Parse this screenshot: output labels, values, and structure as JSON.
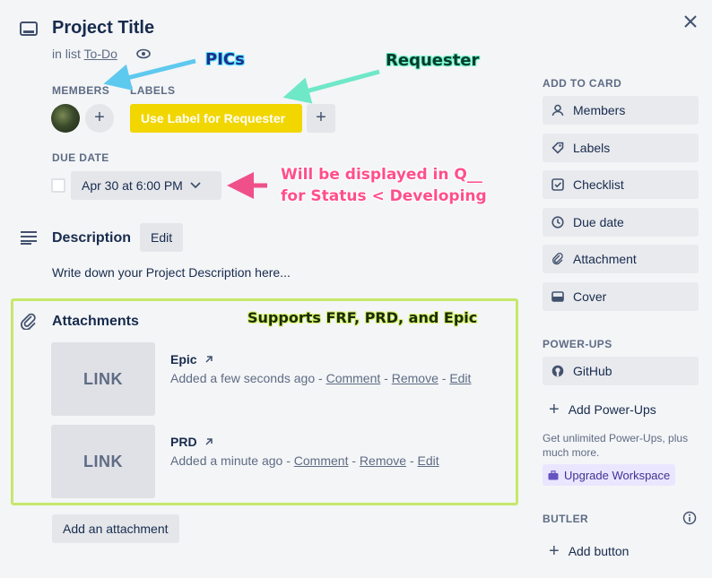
{
  "card": {
    "title": "Project Title",
    "in_list_prefix": "in list",
    "list_name": "To-Do"
  },
  "members": {
    "label": "MEMBERS",
    "add": "+"
  },
  "labels": {
    "label": "LABELS",
    "pill": "Use Label for Requester",
    "pill_color": "#f2d600",
    "add": "+"
  },
  "due": {
    "label": "DUE DATE",
    "value": "Apr 30 at 6:00 PM"
  },
  "description": {
    "heading": "Description",
    "edit": "Edit",
    "text": "Write down your Project Description here..."
  },
  "attachments": {
    "heading": "Attachments",
    "items": [
      {
        "thumb": "LINK",
        "name": "Epic",
        "meta": "Added a few seconds ago",
        "comment": "Comment",
        "remove": "Remove",
        "edit": "Edit"
      },
      {
        "thumb": "LINK",
        "name": "PRD",
        "meta": "Added a minute ago",
        "comment": "Comment",
        "remove": "Remove",
        "edit": "Edit"
      }
    ],
    "add_button": "Add an attachment"
  },
  "sidebar": {
    "add_to_card": "ADD TO CARD",
    "buttons": [
      "Members",
      "Labels",
      "Checklist",
      "Due date",
      "Attachment",
      "Cover"
    ],
    "powerups_label": "POWER-UPS",
    "github": "GitHub",
    "add_powerups": "Add Power-Ups",
    "promo": "Get unlimited Power-Ups, plus much more.",
    "upgrade": "Upgrade Workspace",
    "butler_label": "BUTLER",
    "add_button": "Add button"
  },
  "annotations": {
    "pics": "PICs",
    "requester": "Requester",
    "due_note_1": "Will be displayed in Q__",
    "due_note_2": "for Status < Developing",
    "supports": "Supports FRF, PRD, and Epic"
  },
  "colors": {
    "pics_arrow": "#5ec9ee",
    "requester_arrow": "#6fe8c8",
    "due_arrow": "#f0508a",
    "highlight_box": "#c6e86b"
  }
}
